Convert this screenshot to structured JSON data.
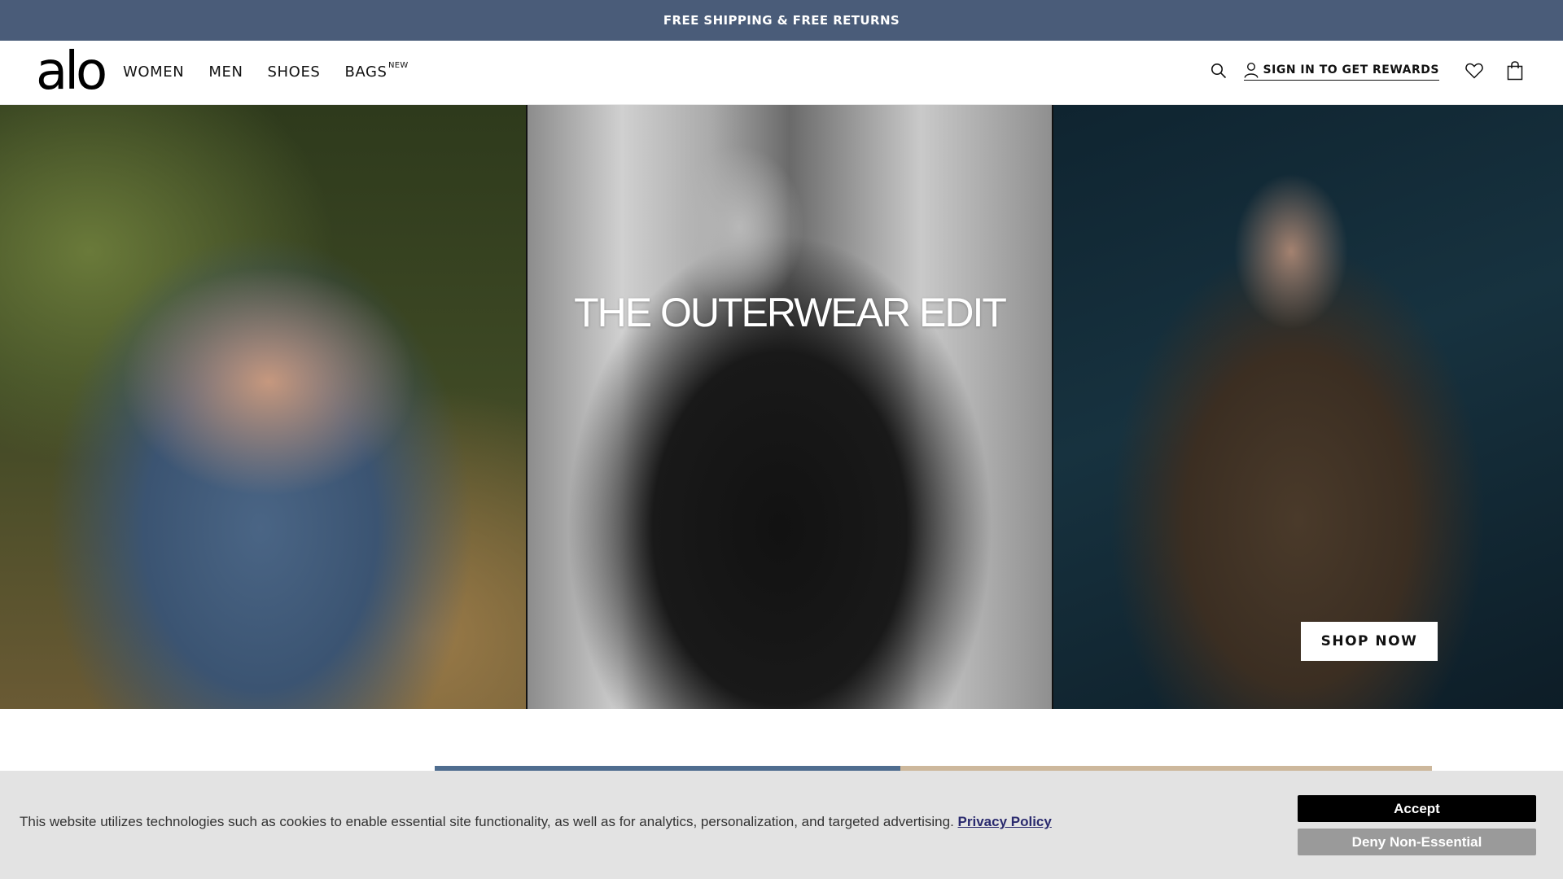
{
  "announcement": {
    "text": "FREE SHIPPING & FREE RETURNS"
  },
  "header": {
    "logo": "alo",
    "nav": [
      {
        "label": "WOMEN"
      },
      {
        "label": "MEN"
      },
      {
        "label": "SHOES"
      },
      {
        "label": "BAGS",
        "badge": "NEW"
      }
    ],
    "search_icon": "search-icon",
    "signin_label": "SIGN IN TO GET REWARDS",
    "user_icon": "user-icon",
    "wishlist_icon": "heart-icon",
    "bag_icon": "shopping-bag-icon"
  },
  "hero": {
    "title": "THE OUTERWEAR EDIT",
    "cta": "SHOP NOW",
    "panels": [
      "model-blue-puffer-jacket",
      "model-black-sherpa-jacket",
      "model-brown-puffer-vest"
    ]
  },
  "cookie_banner": {
    "text": "This website utilizes technologies such as cookies to enable essential site functionality, as well as for analytics, personalization, and targeted advertising.",
    "link": "Privacy Policy",
    "accept": "Accept",
    "deny": "Deny Non-Essential"
  },
  "colors": {
    "announcement_bg": "#4a5c79",
    "cookie_bg": "#e3e3e3",
    "accept_bg": "#000000",
    "deny_bg": "#9a9a9a"
  }
}
